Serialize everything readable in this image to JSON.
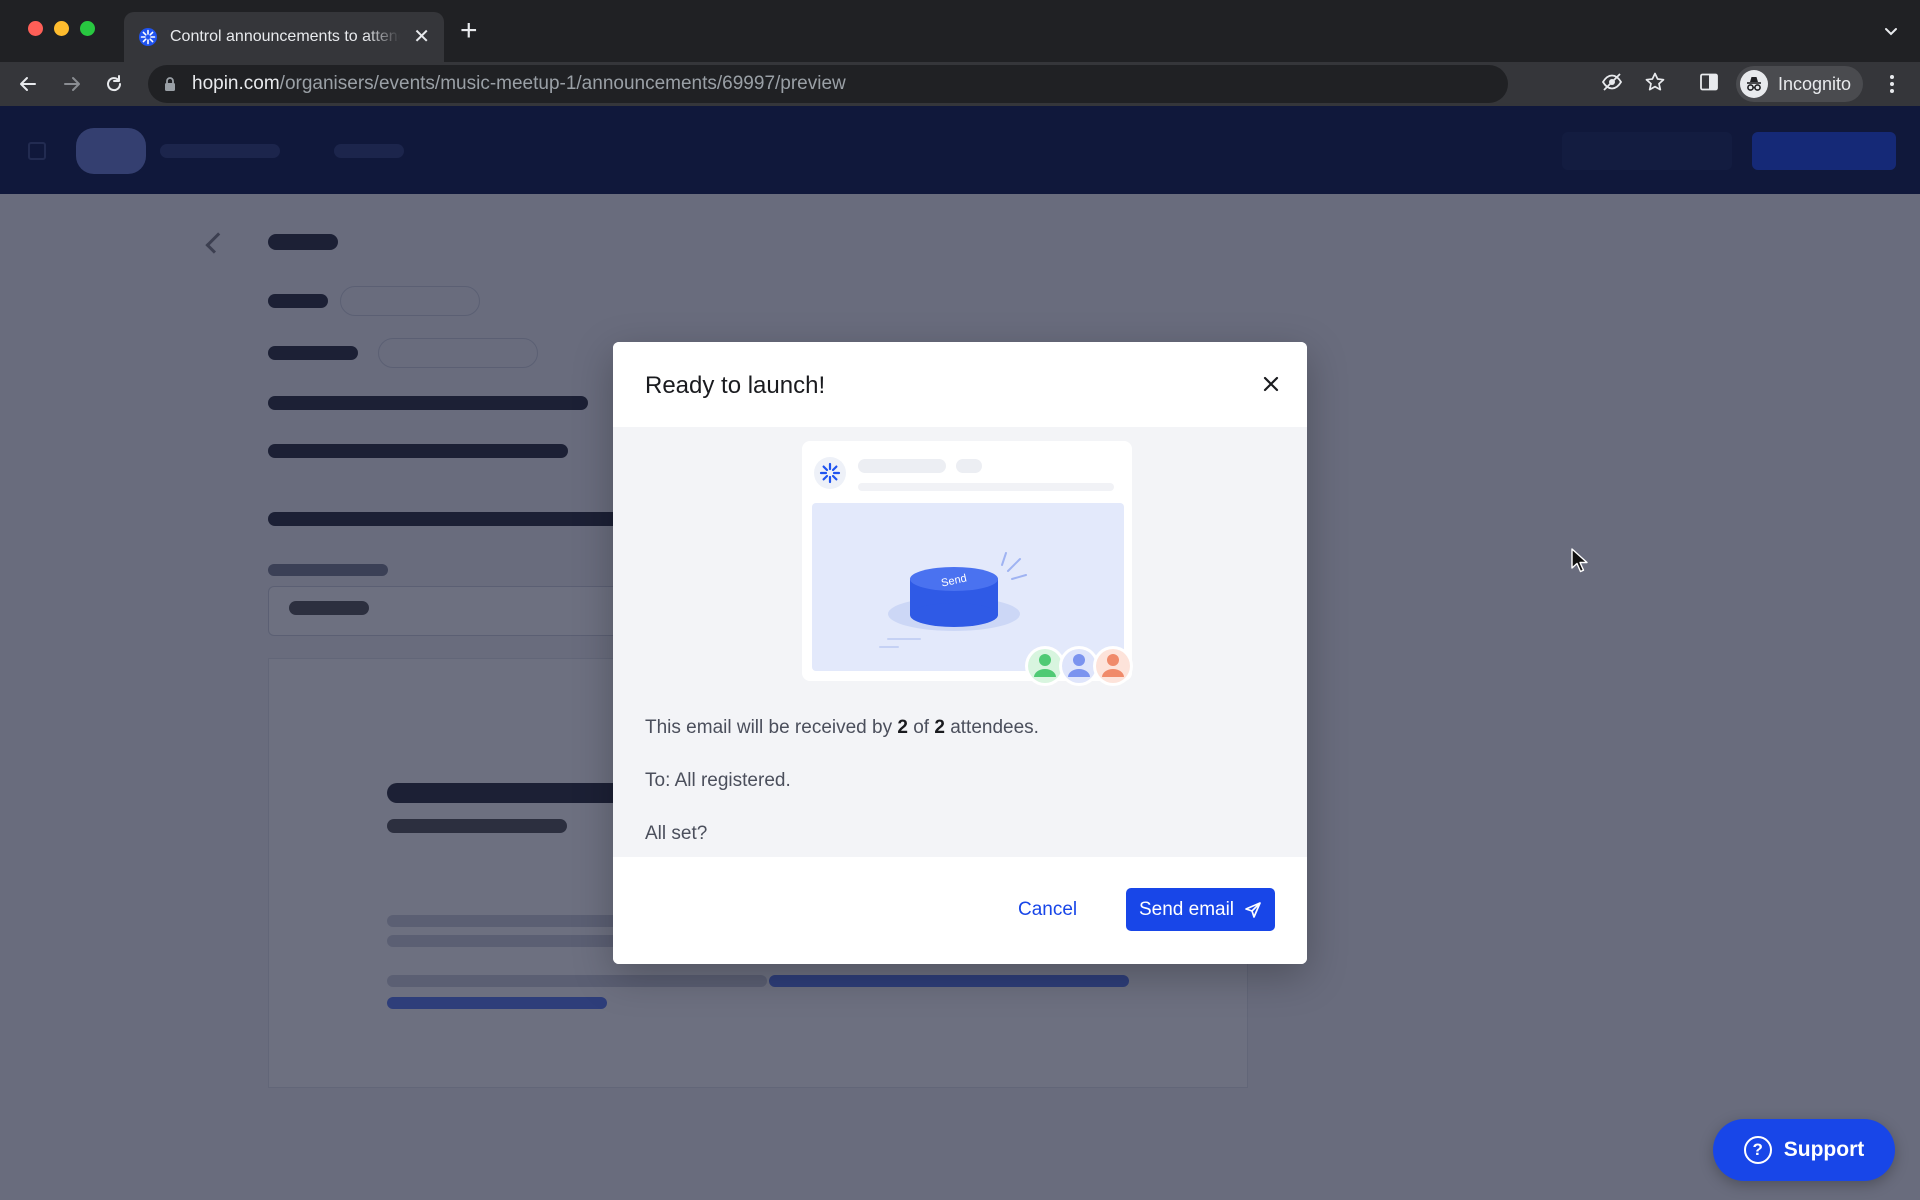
{
  "browser": {
    "tab_title": "Control announcements to attendees",
    "url_host": "hopin.com",
    "url_path": "/organisers/events/music-meetup-1/announcements/69997/preview",
    "profile_label": "Incognito"
  },
  "modal": {
    "title": "Ready to launch!",
    "illustration_button_label": "Send",
    "recipients_prefix": "This email will be received by ",
    "recipients_count": "2",
    "recipients_of": " of ",
    "recipients_total": "2",
    "recipients_suffix": " attendees.",
    "to_line": "To: All registered.",
    "confirm_question": "All set?",
    "cancel_label": "Cancel",
    "send_label": "Send email"
  },
  "support": {
    "label": "Support"
  },
  "colors": {
    "brand_blue": "#1846e8",
    "header_navy": "#0c1a4a",
    "overlay": "rgba(20,25,50,0.62)"
  }
}
